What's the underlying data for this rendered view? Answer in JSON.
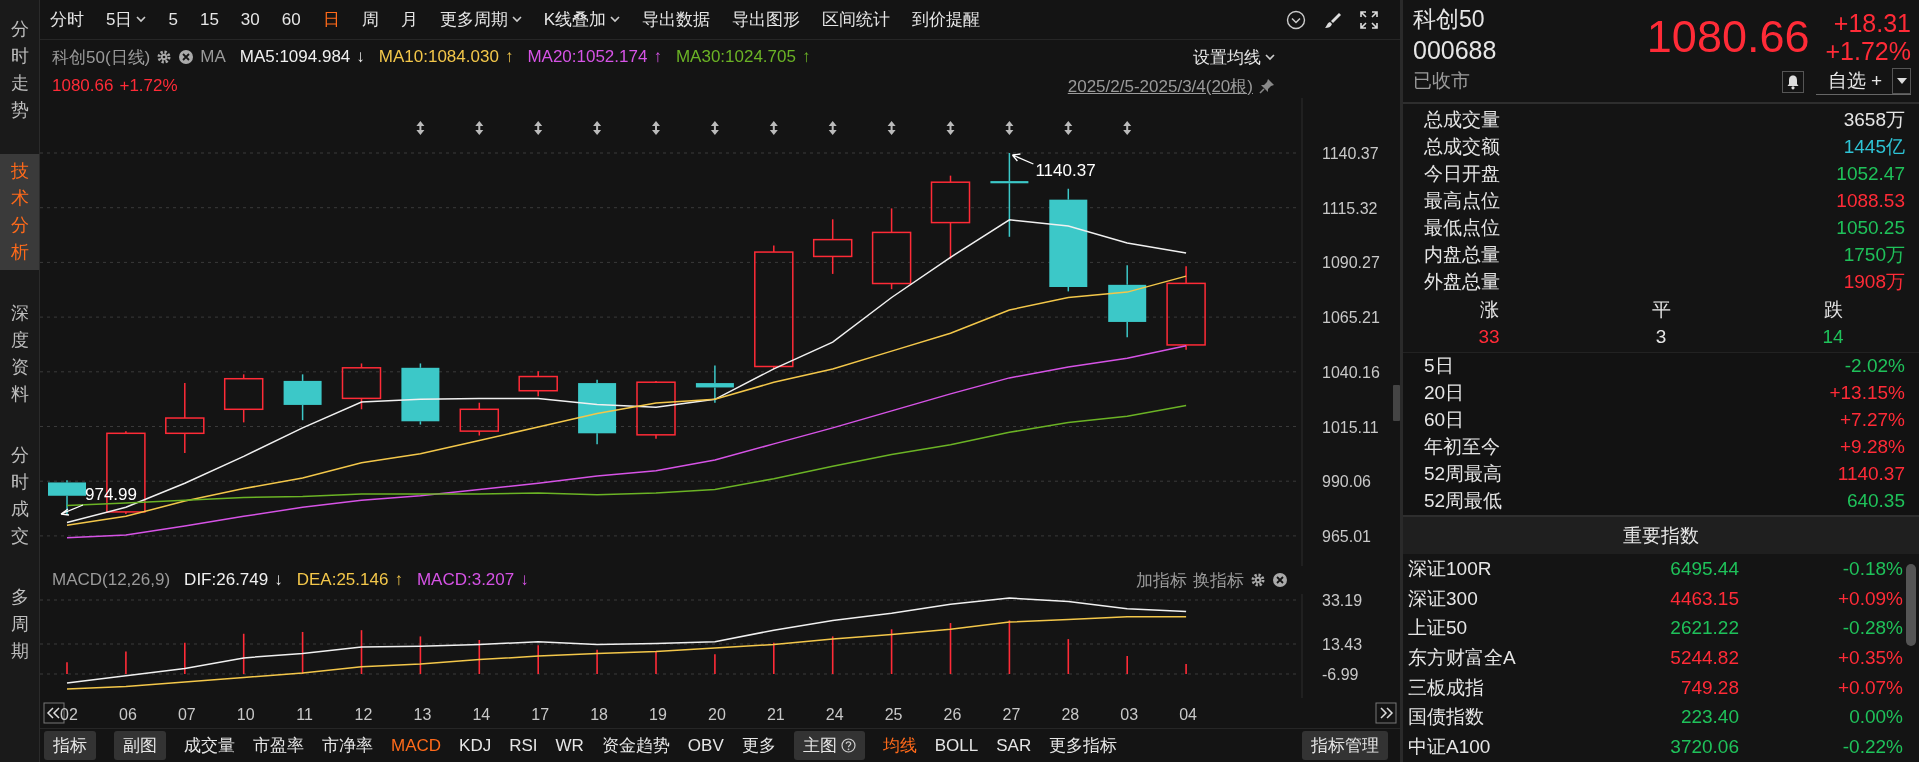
{
  "side_tabs": [
    {
      "label": "分时走势",
      "selected": false
    },
    {
      "label": "技术分析",
      "selected": true
    },
    {
      "label": "深度资料",
      "selected": false
    },
    {
      "label": "分时成交",
      "selected": false
    },
    {
      "label": "多周期",
      "selected": false
    }
  ],
  "period_tabs": [
    {
      "label": "分时",
      "selected": false,
      "dropdown": false
    },
    {
      "label": "5日",
      "selected": false,
      "dropdown": true
    },
    {
      "label": "5",
      "selected": false,
      "dropdown": false
    },
    {
      "label": "15",
      "selected": false,
      "dropdown": false
    },
    {
      "label": "30",
      "selected": false,
      "dropdown": false
    },
    {
      "label": "60",
      "selected": false,
      "dropdown": false
    },
    {
      "label": "日",
      "selected": true,
      "dropdown": false
    },
    {
      "label": "周",
      "selected": false,
      "dropdown": false
    },
    {
      "label": "月",
      "selected": false,
      "dropdown": false
    },
    {
      "label": "更多周期",
      "selected": false,
      "dropdown": true
    }
  ],
  "toolbar_actions": [
    {
      "label": "K线叠加",
      "dropdown": true
    },
    {
      "label": "导出数据",
      "dropdown": false
    },
    {
      "label": "导出图形",
      "dropdown": false
    },
    {
      "label": "区间统计",
      "dropdown": false
    },
    {
      "label": "到价提醒",
      "dropdown": false
    }
  ],
  "main_chart": {
    "title": "科创50(日线)",
    "ma_label": "MA",
    "ma_values": [
      {
        "text": "MA5:1094.984",
        "arrow": "↓",
        "color": "#f0f0f0"
      },
      {
        "text": "MA10:1084.030",
        "arrow": "↑",
        "color": "#f3c74a"
      },
      {
        "text": "MA20:1052.174",
        "arrow": "↑",
        "color": "#d653e6"
      },
      {
        "text": "MA30:1024.705",
        "arrow": "↑",
        "color": "#6bb325"
      }
    ],
    "set_ma": "设置均线",
    "price": "1080.66",
    "change": "+1.72%",
    "date_range": "2025/2/5-2025/3/4(20根)",
    "y_ticks": [
      "1140.37",
      "1115.32",
      "1090.27",
      "1065.21",
      "1040.16",
      "1015.11",
      "990.06",
      "965.01"
    ],
    "high_label": "1140.37",
    "low_label": "974.99"
  },
  "macd": {
    "title": "MACD(12,26,9)",
    "values": [
      {
        "text": "DIF:26.749",
        "arrow": "↓",
        "color": "#f0f0f0"
      },
      {
        "text": "DEA:25.146",
        "arrow": "↑",
        "color": "#f3c74a"
      },
      {
        "text": "MACD:3.207",
        "arrow": "↓",
        "color": "#d653e6"
      }
    ],
    "add_indicator": "加指标",
    "switch_indicator": "换指标",
    "y_ticks": [
      "33.19",
      "13.43",
      "-6.99"
    ]
  },
  "x_labels": [
    "02",
    "06",
    "07",
    "10",
    "11",
    "12",
    "13",
    "14",
    "17",
    "18",
    "19",
    "20",
    "21",
    "24",
    "25",
    "26",
    "27",
    "28",
    "03",
    "04"
  ],
  "bottom_toolbar": {
    "indicator_button": "指标",
    "sub_chart_button": "副图",
    "sub_tabs": [
      {
        "label": "成交量",
        "selected": false
      },
      {
        "label": "市盈率",
        "selected": false
      },
      {
        "label": "市净率",
        "selected": false
      },
      {
        "label": "MACD",
        "selected": true
      },
      {
        "label": "KDJ",
        "selected": false
      },
      {
        "label": "RSI",
        "selected": false
      },
      {
        "label": "WR",
        "selected": false
      },
      {
        "label": "资金趋势",
        "selected": false
      },
      {
        "label": "OBV",
        "selected": false
      },
      {
        "label": "更多",
        "selected": false
      }
    ],
    "main_chart_button": "主图",
    "main_tabs": [
      {
        "label": "均线",
        "selected": true
      },
      {
        "label": "BOLL",
        "selected": false
      },
      {
        "label": "SAR",
        "selected": false
      },
      {
        "label": "更多指标",
        "selected": false
      }
    ],
    "manage_button": "指标管理"
  },
  "quote": {
    "name": "科创50",
    "code": "000688",
    "status": "已收市",
    "price": "1080.66",
    "change": "+18.31",
    "change_pct": "+1.72%",
    "watch_button": "自选 +"
  },
  "stats": [
    {
      "label": "总成交量",
      "value": "3658万",
      "color": "#e6e6e6"
    },
    {
      "label": "总成交额",
      "value": "1445亿",
      "color": "#2ec4d6"
    },
    {
      "label": "今日开盘",
      "value": "1052.47",
      "color": "#1fc15a"
    },
    {
      "label": "最高点位",
      "value": "1088.53",
      "color": "#ff2b37"
    },
    {
      "label": "最低点位",
      "value": "1050.25",
      "color": "#1fc15a"
    },
    {
      "label": "内盘总量",
      "value": "1750万",
      "color": "#1fc15a"
    },
    {
      "label": "外盘总量",
      "value": "1908万",
      "color": "#ff2b37"
    }
  ],
  "breadth": [
    {
      "label": "涨",
      "value": "33",
      "color": "#ff2b37"
    },
    {
      "label": "平",
      "value": "3",
      "color": "#e6e6e6"
    },
    {
      "label": "跌",
      "value": "14",
      "color": "#1fc15a"
    }
  ],
  "returns": [
    {
      "label": "5日",
      "value": "-2.02%",
      "color": "#1fc15a"
    },
    {
      "label": "20日",
      "value": "+13.15%",
      "color": "#ff2b37"
    },
    {
      "label": "60日",
      "value": "+7.27%",
      "color": "#ff2b37"
    },
    {
      "label": "年初至今",
      "value": "+9.28%",
      "color": "#ff2b37"
    },
    {
      "label": "52周最高",
      "value": "1140.37",
      "color": "#ff2b37"
    },
    {
      "label": "52周最低",
      "value": "640.35",
      "color": "#1fc15a"
    }
  ],
  "indices": {
    "title": "重要指数",
    "rows": [
      {
        "name": "深证100R",
        "value": "6495.44",
        "change": "-0.18%",
        "color": "#1fc15a"
      },
      {
        "name": "深证300",
        "value": "4463.15",
        "change": "+0.09%",
        "color": "#ff2b37"
      },
      {
        "name": "上证50",
        "value": "2621.22",
        "change": "-0.28%",
        "color": "#1fc15a"
      },
      {
        "name": "东方财富全A",
        "value": "5244.82",
        "change": "+0.35%",
        "color": "#ff2b37"
      },
      {
        "name": "三板成指",
        "value": "749.28",
        "change": "+0.07%",
        "color": "#ff2b37"
      },
      {
        "name": "国债指数",
        "value": "223.40",
        "change": "0.00%",
        "color": "#1fc15a"
      },
      {
        "name": "中证A100",
        "value": "3720.06",
        "change": "-0.22%",
        "color": "#1fc15a"
      }
    ]
  }
}
